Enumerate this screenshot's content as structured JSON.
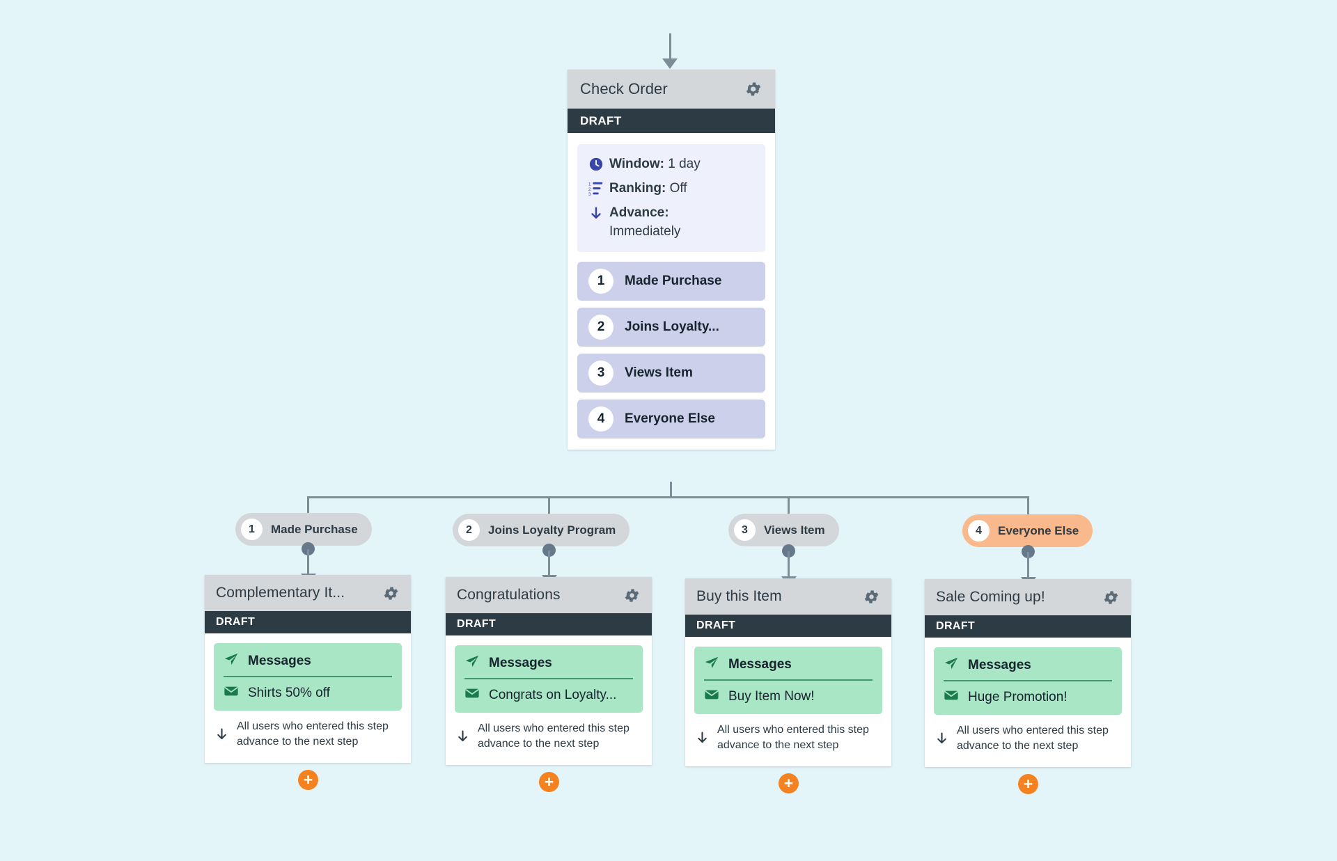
{
  "theme": {
    "background": "#e4f5fa",
    "card_header_bg": "#d4d7d9",
    "draft_bar_bg": "#2d3b45",
    "settings_bg": "#eef0fb",
    "branch_row_bg": "#ccd0ea",
    "pill_bg": "#d4d7d9",
    "pill_accent_bg": "#f9b98c",
    "message_box_bg": "#a9e6c6",
    "message_accent": "#2e8a5d",
    "connector": "#7e8e99",
    "plus_button": "#f58220",
    "icon_indigo": "#3a45a8"
  },
  "root": {
    "title": "Check Order",
    "gear_icon": "gear-icon",
    "status": "DRAFT",
    "settings": [
      {
        "icon": "clock-icon",
        "label": "Window:",
        "value": "1 day"
      },
      {
        "icon": "ranking-list-icon",
        "label": "Ranking:",
        "value": "Off"
      },
      {
        "icon": "arrow-down-icon",
        "label": "Advance:",
        "value": "Immediately"
      }
    ],
    "branches": [
      {
        "number": "1",
        "label": "Made Purchase"
      },
      {
        "number": "2",
        "label": "Joins Loyalty..."
      },
      {
        "number": "3",
        "label": "Views Item"
      },
      {
        "number": "4",
        "label": "Everyone Else"
      }
    ]
  },
  "pills": [
    {
      "number": "1",
      "label": "Made Purchase",
      "accent": false
    },
    {
      "number": "2",
      "label": "Joins Loyalty Program",
      "accent": false
    },
    {
      "number": "3",
      "label": "Views Item",
      "accent": false
    },
    {
      "number": "4",
      "label": "Everyone Else",
      "accent": true
    }
  ],
  "cards": [
    {
      "title": "Complementary It...",
      "gear_icon": "gear-icon",
      "status": "DRAFT",
      "messages_label": "Messages",
      "messages_icon": "paper-plane-icon",
      "message_item_icon": "envelope-icon",
      "message_item": "Shirts 50% off",
      "advance_icon": "arrow-down-icon",
      "advance_text": "All users who entered this step advance to the next step",
      "plus_label": "+"
    },
    {
      "title": "Congratulations",
      "gear_icon": "gear-icon",
      "status": "DRAFT",
      "messages_label": "Messages",
      "messages_icon": "paper-plane-icon",
      "message_item_icon": "envelope-icon",
      "message_item": "Congrats on Loyalty...",
      "advance_icon": "arrow-down-icon",
      "advance_text": "All users who entered this step advance to the next step",
      "plus_label": "+"
    },
    {
      "title": "Buy this Item",
      "gear_icon": "gear-icon",
      "status": "DRAFT",
      "messages_label": "Messages",
      "messages_icon": "paper-plane-icon",
      "message_item_icon": "envelope-icon",
      "message_item": "Buy Item Now!",
      "advance_icon": "arrow-down-icon",
      "advance_text": "All users who entered this step advance to the next step",
      "plus_label": "+"
    },
    {
      "title": "Sale Coming up!",
      "gear_icon": "gear-icon",
      "status": "DRAFT",
      "messages_label": "Messages",
      "messages_icon": "paper-plane-icon",
      "message_item_icon": "envelope-icon",
      "message_item": "Huge Promotion!",
      "advance_icon": "arrow-down-icon",
      "advance_text": "All users who entered this step advance to the next step",
      "plus_label": "+"
    }
  ]
}
